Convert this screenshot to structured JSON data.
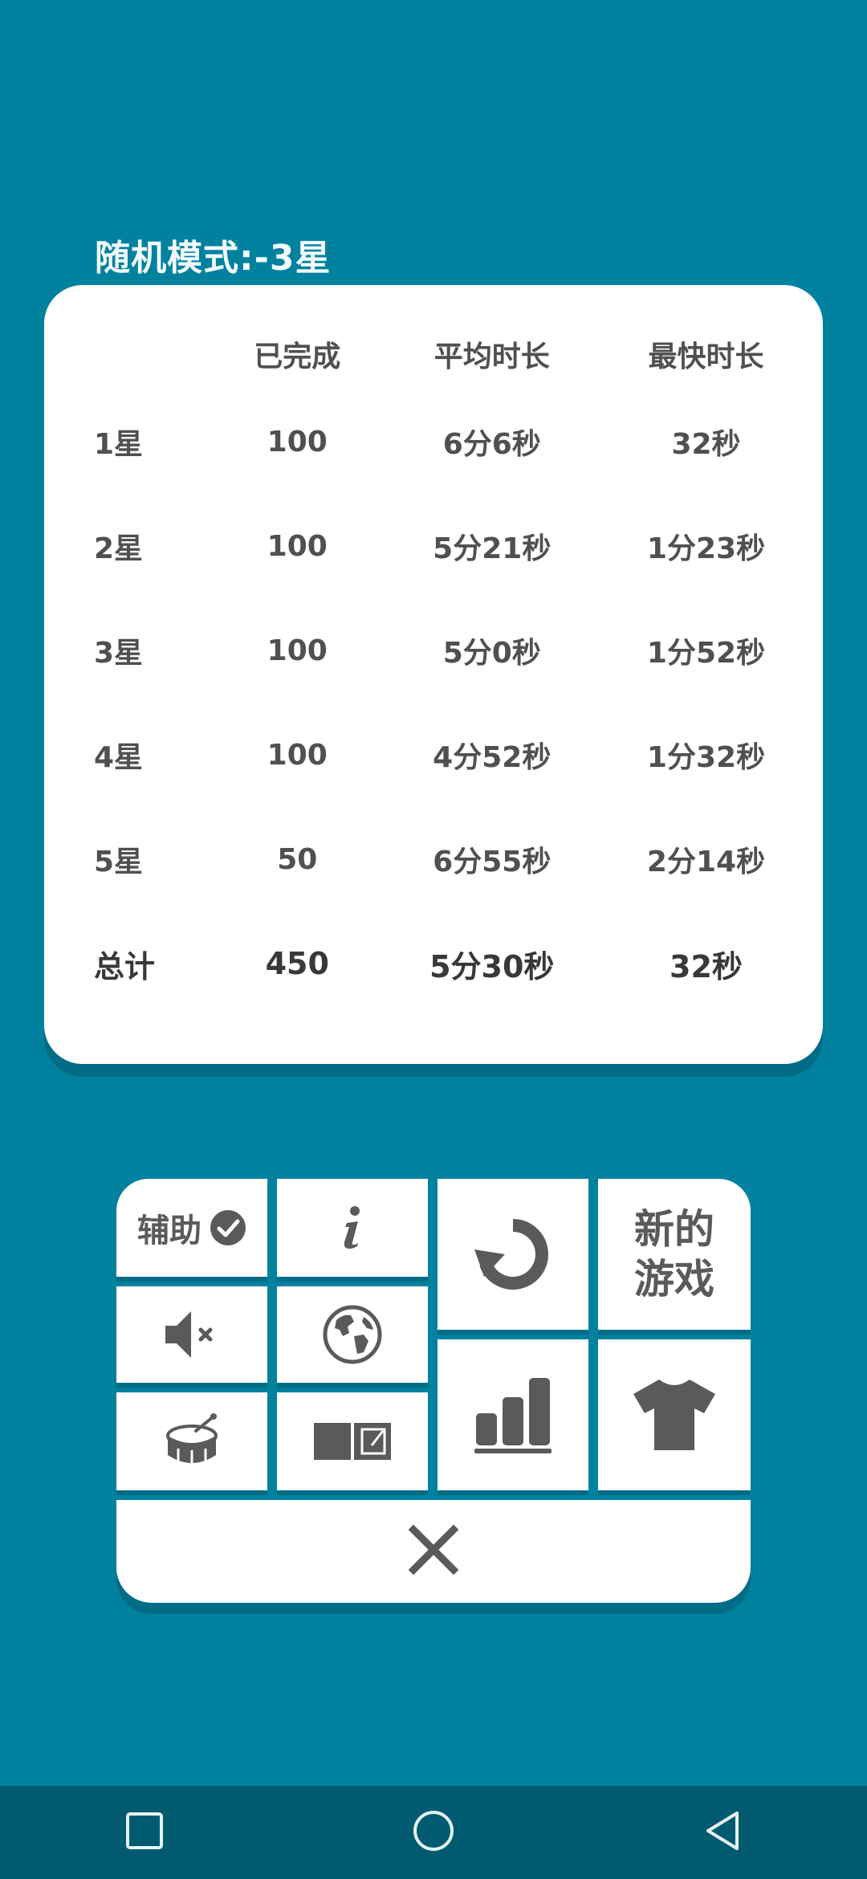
{
  "mode_title": "随机模式:-3星",
  "table": {
    "headers": [
      "",
      "已完成",
      "平均时长",
      "最快时长"
    ],
    "rows": [
      {
        "label": "1星",
        "completed": "100",
        "avg": "6分6秒",
        "best": "32秒"
      },
      {
        "label": "2星",
        "completed": "100",
        "avg": "5分21秒",
        "best": "1分23秒"
      },
      {
        "label": "3星",
        "completed": "100",
        "avg": "5分0秒",
        "best": "1分52秒"
      },
      {
        "label": "4星",
        "completed": "100",
        "avg": "4分52秒",
        "best": "1分32秒"
      },
      {
        "label": "5星",
        "completed": "50",
        "avg": "6分55秒",
        "best": "2分14秒"
      }
    ],
    "total": {
      "label": "总计",
      "completed": "450",
      "avg": "5分30秒",
      "best": "32秒"
    }
  },
  "menu": {
    "assist_label": "辅助",
    "new_game_label": "新的游戏",
    "icons": {
      "assist": "check-circle-icon",
      "info": "info-icon",
      "restart": "restart-icon",
      "mute": "speaker-muted-icon",
      "language": "globe-icon",
      "stats": "bar-chart-icon",
      "drum": "drum-icon",
      "notes": "notes-toggle-icon",
      "theme": "tshirt-icon",
      "close": "close-icon"
    }
  },
  "navbar": {
    "icons": [
      "square-recents-icon",
      "circle-home-icon",
      "triangle-back-icon"
    ]
  },
  "colors": {
    "background": "#00829f",
    "card": "#ffffff",
    "text": "#505050",
    "navbar": "#005a70"
  }
}
